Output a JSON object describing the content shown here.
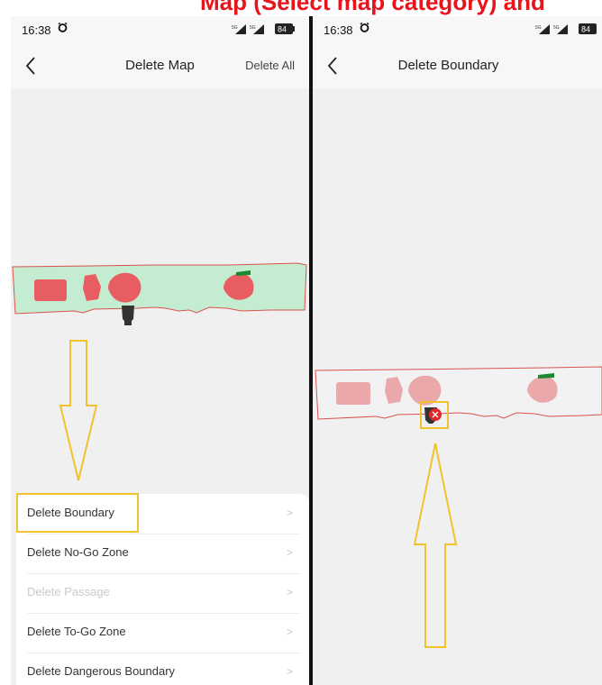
{
  "caption": "Map (Select map category) and",
  "left_screen": {
    "status": {
      "time": "16:38",
      "battery": "84",
      "signal_labels": [
        "5G",
        "5G"
      ]
    },
    "header": {
      "back_icon": "chevron-left-icon",
      "title": "Delete Map",
      "action": "Delete All"
    },
    "menu": {
      "items": [
        {
          "label": "Delete Boundary",
          "enabled": true,
          "highlighted": true
        },
        {
          "label": "Delete No-Go Zone",
          "enabled": true
        },
        {
          "label": "Delete Passage",
          "enabled": false
        },
        {
          "label": "Delete To-Go Zone",
          "enabled": true
        },
        {
          "label": "Delete Dangerous Boundary",
          "enabled": true
        }
      ],
      "chevron": ">"
    }
  },
  "right_screen": {
    "status": {
      "time": "16:38",
      "battery": "84",
      "signal_labels": [
        "5G",
        "5G"
      ]
    },
    "header": {
      "back_icon": "chevron-left-icon",
      "title": "Delete Boundary"
    },
    "delete_marker_icon": "close-icon"
  },
  "colors": {
    "annotation": "#f2c12e",
    "caption": "#e8141b",
    "map_fill": "#c4ecd0",
    "zone_red": "#e85d62",
    "zone_pink": "#eba8aa",
    "boundary_line": "#d9534f",
    "station_marker": "#1a8a2e"
  }
}
